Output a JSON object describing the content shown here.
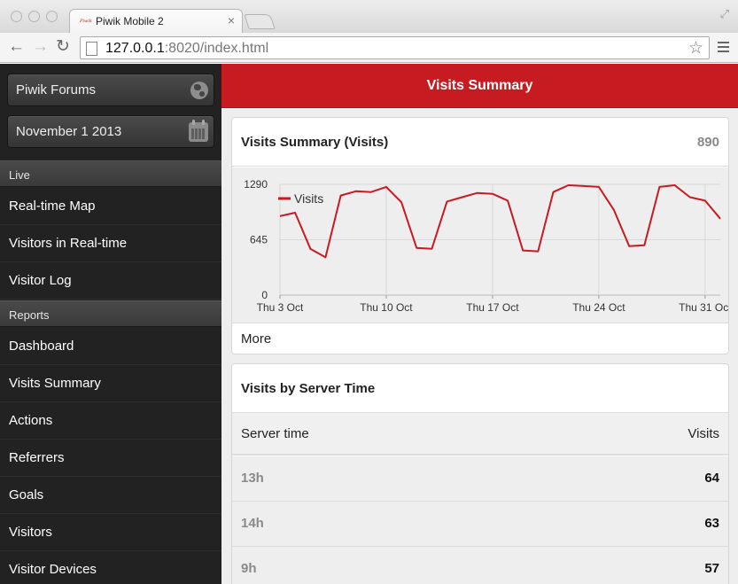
{
  "browser": {
    "tab_title": "Piwik Mobile 2",
    "favicon_text": "Piwik",
    "tab_close": "×",
    "url_host": "127.0.0.1",
    "url_rest": ":8020/index.html"
  },
  "sidebar": {
    "site_button": "Piwik Forums",
    "date_button": "November 1 2013",
    "sections": [
      {
        "title": "Live",
        "items": [
          "Real-time Map",
          "Visitors in Real-time",
          "Visitor Log"
        ]
      },
      {
        "title": "Reports",
        "items": [
          "Dashboard",
          "Visits Summary",
          "Actions",
          "Referrers",
          "Goals",
          "Visitors",
          "Visitor Devices"
        ]
      }
    ]
  },
  "header": {
    "title": "Visits Summary"
  },
  "summary_card": {
    "title": "Visits Summary (Visits)",
    "total": "890",
    "more_label": "More"
  },
  "chart_data": {
    "type": "line",
    "series": [
      {
        "name": "Visits",
        "color": "#c71b22",
        "values": [
          920,
          960,
          540,
          440,
          1160,
          1210,
          1200,
          1260,
          1080,
          550,
          540,
          1090,
          1140,
          1190,
          1180,
          1100,
          520,
          510,
          1200,
          1280,
          1270,
          1260,
          990,
          570,
          580,
          1260,
          1280,
          1140,
          1100,
          890
        ]
      }
    ],
    "x_dates": [
      "2013-10-03",
      "2013-10-04",
      "2013-10-05",
      "2013-10-06",
      "2013-10-07",
      "2013-10-08",
      "2013-10-09",
      "2013-10-10",
      "2013-10-11",
      "2013-10-12",
      "2013-10-13",
      "2013-10-14",
      "2013-10-15",
      "2013-10-16",
      "2013-10-17",
      "2013-10-18",
      "2013-10-19",
      "2013-10-20",
      "2013-10-21",
      "2013-10-22",
      "2013-10-23",
      "2013-10-24",
      "2013-10-25",
      "2013-10-26",
      "2013-10-27",
      "2013-10-28",
      "2013-10-29",
      "2013-10-30",
      "2013-10-31",
      "2013-11-01"
    ],
    "x_tick_labels": [
      "Thu 3 Oct",
      "Thu 10 Oct",
      "Thu 17 Oct",
      "Thu 24 Oct",
      "Thu 31 Oct"
    ],
    "y_tick_labels": [
      "0",
      "645",
      "1290"
    ],
    "ylim": [
      0,
      1290
    ],
    "legend_position": "top-left",
    "grid": true
  },
  "server_time_card": {
    "title": "Visits by Server Time",
    "columns": [
      "Server time",
      "Visits"
    ],
    "rows": [
      {
        "time": "13h",
        "visits": "64"
      },
      {
        "time": "14h",
        "visits": "63"
      },
      {
        "time": "9h",
        "visits": "57"
      }
    ]
  }
}
